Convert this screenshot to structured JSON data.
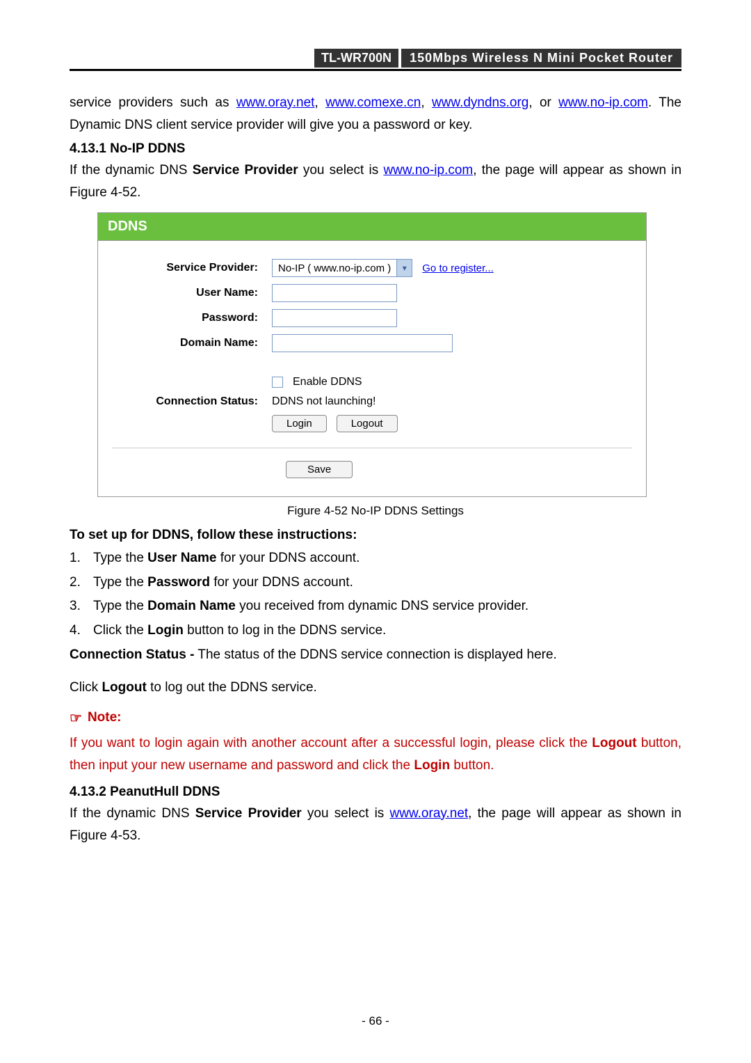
{
  "header": {
    "model": "TL-WR700N",
    "title": "150Mbps Wireless N Mini Pocket Router"
  },
  "intro": {
    "prefix": "service providers such as ",
    "link1": "www.oray.net",
    "sep1": ", ",
    "link2": "www.comexe.cn",
    "sep2": ", ",
    "link3": "www.dyndns.org",
    "sep3": ", or ",
    "link4": "www.no-ip.com",
    "suffix": ". The Dynamic DNS client service provider will give you a password or key."
  },
  "section1": {
    "heading": "4.13.1 No-IP DDNS",
    "p_prefix": "If the dynamic DNS ",
    "p_bold1": "Service Provider",
    "p_mid": " you select is ",
    "p_link": "www.no-ip.com",
    "p_suffix": ", the page will appear as shown in Figure 4-52."
  },
  "figure": {
    "title": "DDNS",
    "labels": {
      "provider": "Service Provider:",
      "username": "User Name:",
      "password": "Password:",
      "domain": "Domain Name:",
      "connstatus": "Connection Status:"
    },
    "provider_value": "No-IP ( www.no-ip.com )",
    "register_link": "Go to register...",
    "enable_label": "Enable DDNS",
    "status_text": "DDNS not launching!",
    "login_btn": "Login",
    "logout_btn": "Logout",
    "save_btn": "Save",
    "caption": "Figure 4-52 No-IP DDNS Settings"
  },
  "instructions": {
    "heading": "To set up for DDNS, follow these instructions:",
    "items": [
      {
        "n": "1.",
        "pre": "Type the ",
        "b": "User Name",
        "post": " for your DDNS account."
      },
      {
        "n": "2.",
        "pre": "Type the ",
        "b": "Password",
        "post": " for your DDNS account."
      },
      {
        "n": "3.",
        "pre": "Type the ",
        "b": "Domain Name",
        "post": " you received from dynamic DNS service provider."
      },
      {
        "n": "4.",
        "pre": "Click the ",
        "b": "Login",
        "post": " button to log in the DDNS service."
      }
    ],
    "conn_b": "Connection Status -",
    "conn_text": " The status of the DDNS service connection is displayed here.",
    "logout_pre": "Click ",
    "logout_b": "Logout",
    "logout_post": " to log out the DDNS service."
  },
  "note": {
    "heading": "Note:",
    "body_pre": "If you want to login again with another account after a successful login, please click the ",
    "body_b1": "Logout",
    "body_mid": " button, then input your new username and password and click the ",
    "body_b2": "Login",
    "body_post": " button."
  },
  "section2": {
    "heading": "4.13.2 PeanutHull DDNS",
    "p_prefix": "If the dynamic DNS ",
    "p_bold1": "Service Provider",
    "p_mid": " you select is ",
    "p_link": "www.oray.net",
    "p_suffix": ", the page will appear as shown in Figure 4-53."
  },
  "page_number": "- 66 -"
}
